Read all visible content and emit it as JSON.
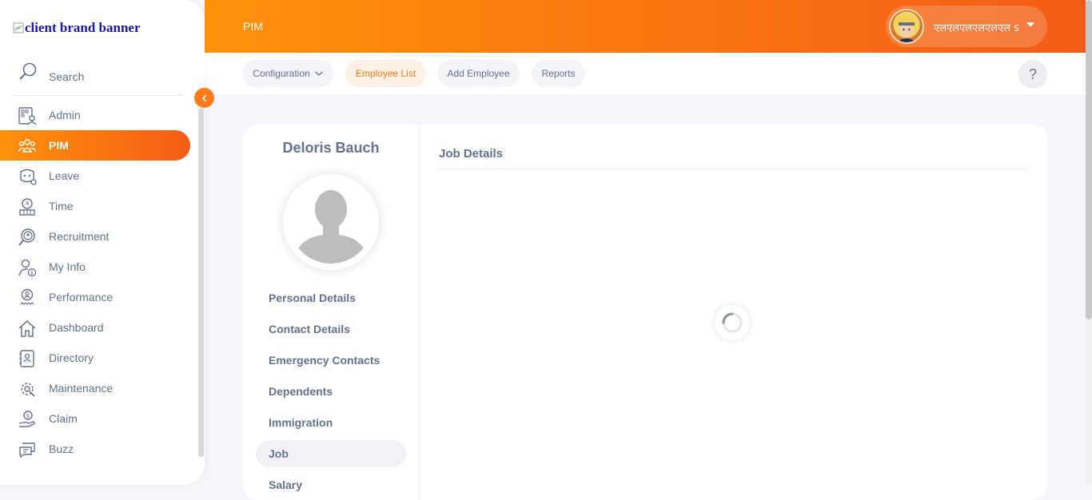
{
  "brand": {
    "alt_text": "client brand banner"
  },
  "sidebar": {
    "search_label": "Search",
    "items": [
      {
        "label": "Admin",
        "icon": "admin-icon"
      },
      {
        "label": "PIM",
        "icon": "pim-icon",
        "active": true
      },
      {
        "label": "Leave",
        "icon": "leave-icon"
      },
      {
        "label": "Time",
        "icon": "time-icon"
      },
      {
        "label": "Recruitment",
        "icon": "recruitment-icon"
      },
      {
        "label": "My Info",
        "icon": "my-info-icon"
      },
      {
        "label": "Performance",
        "icon": "performance-icon"
      },
      {
        "label": "Dashboard",
        "icon": "dashboard-icon"
      },
      {
        "label": "Directory",
        "icon": "directory-icon"
      },
      {
        "label": "Maintenance",
        "icon": "maintenance-icon"
      },
      {
        "label": "Claim",
        "icon": "claim-icon"
      },
      {
        "label": "Buzz",
        "icon": "buzz-icon"
      }
    ]
  },
  "header": {
    "title": "PIM",
    "user_name": "एलएलएलएलएलएल s"
  },
  "subnav": {
    "configuration": "Configuration",
    "employee_list": "Employee List",
    "add_employee": "Add Employee",
    "reports": "Reports",
    "help": "?"
  },
  "employee": {
    "name": "Deloris Bauch",
    "tabs": [
      {
        "label": "Personal Details"
      },
      {
        "label": "Contact Details"
      },
      {
        "label": "Emergency Contacts"
      },
      {
        "label": "Dependents"
      },
      {
        "label": "Immigration"
      },
      {
        "label": "Job",
        "active": true
      },
      {
        "label": "Salary"
      }
    ]
  },
  "main": {
    "section_title": "Job Details"
  },
  "colors": {
    "accent": "#ff7b1d",
    "gradient_start": "#ff920b",
    "gradient_end": "#f35c17",
    "text": "#64728c"
  }
}
